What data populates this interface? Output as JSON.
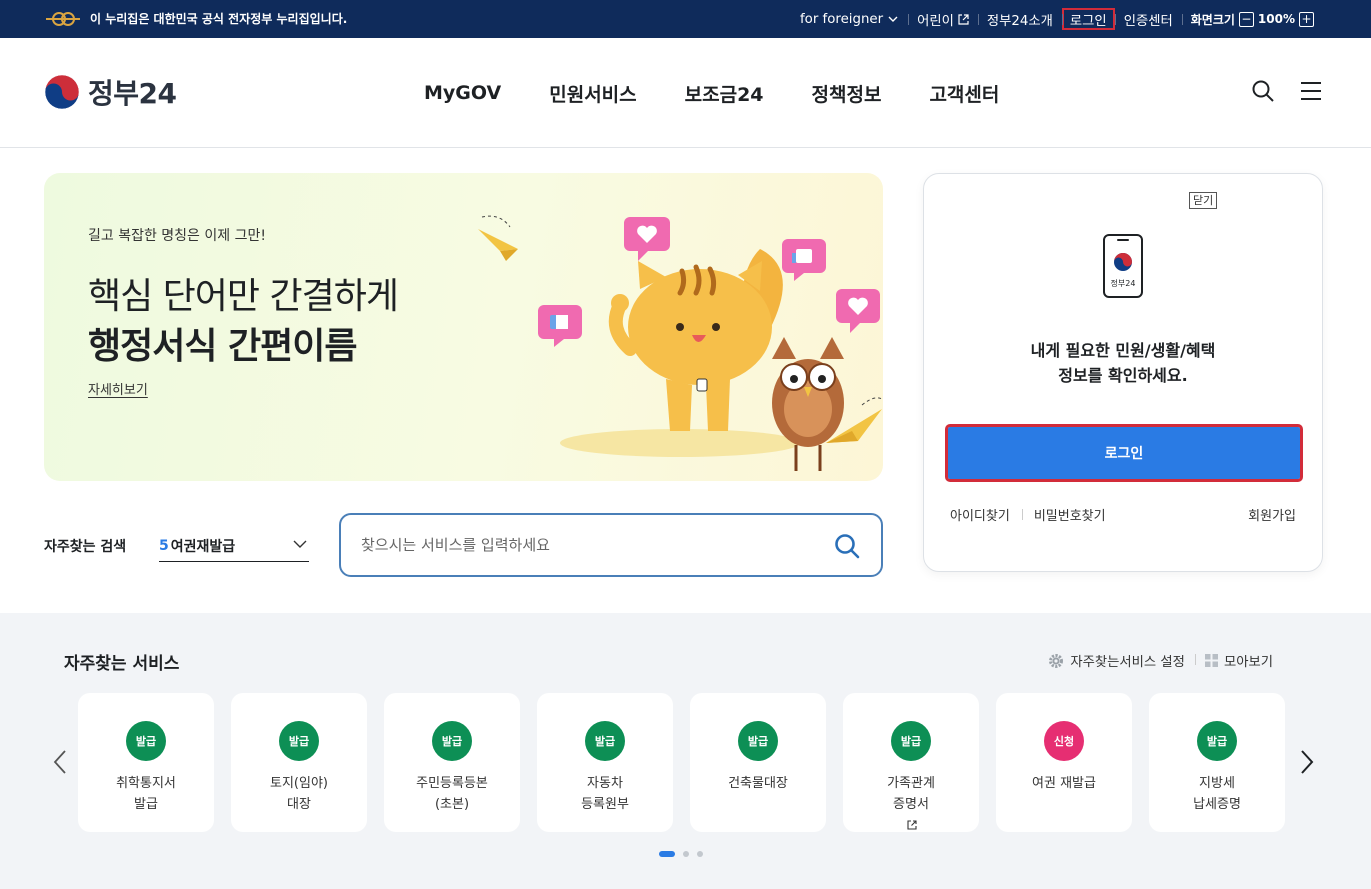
{
  "topbar": {
    "notice": "이 누리집은 대한민국 공식 전자정부 누리집입니다.",
    "links": [
      {
        "label": "for foreigner",
        "icon": "chevron-down-icon"
      },
      {
        "label": "어린이",
        "icon": "external-link-icon"
      },
      {
        "label": "정부24소개"
      },
      {
        "label": "로그인"
      },
      {
        "label": "인증센터"
      }
    ],
    "zoom": {
      "label": "화면크기",
      "minus": "−",
      "value": "100%",
      "plus": "+"
    }
  },
  "header": {
    "logo_text": "정부24",
    "nav": [
      "MyGOV",
      "민원서비스",
      "보조금24",
      "정책정보",
      "고객센터"
    ],
    "icons": [
      "search-icon",
      "menu-icon"
    ]
  },
  "banner": {
    "eyebrow": "길고 복잡한 명칭은 이제 그만!",
    "headline_1": "핵심 단어만 간결하게",
    "headline_2": "행정서식 간편이름",
    "more_link": "자세히보기"
  },
  "login_card": {
    "close_label": "닫기",
    "phone_label": "정부24",
    "message_1": "내게 필요한 민원/생활/혜택",
    "message_2": "정보를 확인하세요.",
    "login_button": "로그인",
    "find_id": "아이디찾기",
    "find_password": "비밀번호찾기",
    "signup": "회원가입",
    "accent_color": "#2a7be4"
  },
  "search": {
    "frequent_label": "자주찾는 검색",
    "frequent_rank": "5",
    "frequent_value": "여권재발급",
    "placeholder": "찾으시는 서비스를 입력하세요"
  },
  "services": {
    "title": "자주찾는 서비스",
    "settings_label": "자주찾는서비스 설정",
    "view_all_label": "모아보기",
    "badge_colors": {
      "발급": "#0d8f55",
      "신청": "#e62e72"
    },
    "items": [
      {
        "badge": "발급",
        "line1": "취학통지서",
        "line2": "발급"
      },
      {
        "badge": "발급",
        "line1": "토지(임야)",
        "line2": "대장"
      },
      {
        "badge": "발급",
        "line1": "주민등록등본",
        "line2": "(초본)"
      },
      {
        "badge": "발급",
        "line1": "자동차",
        "line2": "등록원부"
      },
      {
        "badge": "발급",
        "line1": "건축물대장",
        "line2": ""
      },
      {
        "badge": "발급",
        "line1": "가족관계",
        "line2": "증명서"
      },
      {
        "badge": "신청",
        "line1": "여권 재발급",
        "line2": ""
      },
      {
        "badge": "발급",
        "line1": "지방세",
        "line2": "납세증명"
      }
    ],
    "page_count": 3,
    "active_page": 1
  }
}
